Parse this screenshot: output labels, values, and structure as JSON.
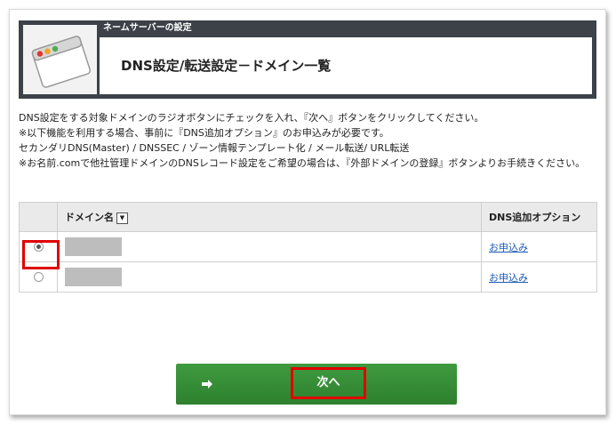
{
  "header": {
    "subtitle": "ネームサーバーの設定",
    "title": "DNS設定/転送設定－ドメイン一覧"
  },
  "description": {
    "lines": [
      "DNS設定をする対象ドメインのラジオボタンにチェックを入れ、『次へ』ボタンをクリックしてください。",
      "※以下機能を利用する場合、事前に『DNS追加オプション』のお申込みが必要です。",
      "セカンダリDNS(Master) / DNSSEC / ゾーン情報テンプレート化 / メール転送/ URL転送",
      "※お名前.comで他社管理ドメインのDNSレコード設定をご希望の場合は、『外部ドメインの登録』ボタンよりお手続きください。"
    ]
  },
  "table": {
    "headers": [
      "",
      "ドメイン名",
      "DNS追加オプション"
    ],
    "rows": [
      {
        "selected": true,
        "domain": "",
        "option": "お申込み"
      },
      {
        "selected": false,
        "domain": "",
        "option": "お申込み"
      }
    ]
  },
  "actions": {
    "next_label": "次へ"
  },
  "colors": {
    "header_bg": "#3c4248",
    "button_green": "#339033",
    "highlight_red": "#e00000",
    "link": "#1a5bb3"
  },
  "icons": {
    "header": "browser-window-icon",
    "sort": "sort-down-icon",
    "next": "arrow-right-icon"
  }
}
